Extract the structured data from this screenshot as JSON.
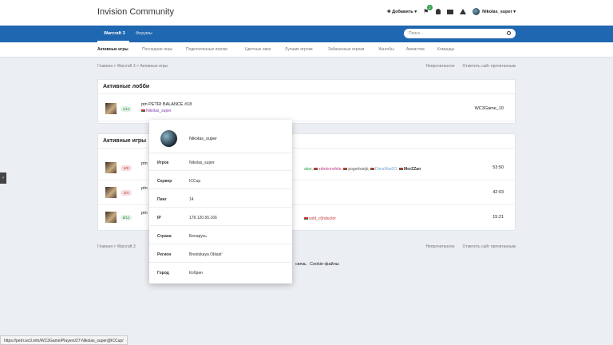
{
  "header": {
    "site_title": "Invision Community",
    "add_label": "✚ Добавить ▾",
    "notification_count": "2",
    "username": "Nikolas_super ▾"
  },
  "nav": {
    "items": [
      {
        "label": "Warcraft 3",
        "active": true
      },
      {
        "label": "Форумы",
        "active": false
      }
    ],
    "search_placeholder": "Поиск..."
  },
  "subnav": {
    "items": [
      {
        "label": "Активные игры",
        "active": true
      },
      {
        "label": "Последние игры"
      },
      {
        "label": "Подключенные игроки"
      },
      {
        "label": "Цветные ники"
      },
      {
        "label": "Лучшие игроки"
      },
      {
        "label": "Забаненные игроки"
      },
      {
        "label": "Жалобы"
      },
      {
        "label": "Амнистии"
      },
      {
        "label": "Команды"
      }
    ]
  },
  "breadcrumb": {
    "items": [
      "Главная",
      "Warcraft 3",
      "Активные игры"
    ],
    "separator": ">",
    "unread_label": "Непрочитанное",
    "mark_read_label": "Отметить сайт прочитанным"
  },
  "lobbies": {
    "title": "Активные лобби",
    "rows": [
      {
        "slots": "1/11",
        "name": "ptn PETRI BALANCE #18",
        "host": "Nikolas_super",
        "server": "WC3Game_10"
      }
    ]
  },
  "games": {
    "title": "Активные игры",
    "rows": [
      {
        "slots": "8/8",
        "name": "ptn",
        "players": [
          "zdmkonohite,",
          "pogerbanjk,",
          "DimaWar0O,",
          "MorZZan"
        ],
        "players_prefix": "aker,",
        "time": "53:50"
      },
      {
        "slots": "3/4",
        "name": "ptn",
        "players": [],
        "time": "42:03"
      },
      {
        "slots": "8/11",
        "name": "ptn",
        "players": [
          "vold_c0nductor"
        ],
        "time": "15:21"
      }
    ]
  },
  "footer": {
    "links": [
      "связь",
      "Cookie-файлы"
    ]
  },
  "popup": {
    "name": "Nikolas_super",
    "fields": [
      {
        "key": "Игрок",
        "value": "Nikolas_super"
      },
      {
        "key": "Сервер",
        "value": "ICCup"
      },
      {
        "key": "Пинг",
        "value": "14"
      },
      {
        "key": "IP",
        "value": "178.120.56.166"
      },
      {
        "key": "Страна",
        "value": "Беларусь"
      },
      {
        "key": "Регион",
        "value": "Brestskaya Oblast'"
      },
      {
        "key": "Город",
        "value": "Кобрин"
      }
    ]
  },
  "statusbar": {
    "url": "https://petri.wc3.info/WC3Game/Players/27-Nikolas_super@ICCup/"
  }
}
